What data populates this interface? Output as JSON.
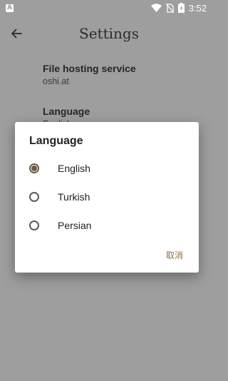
{
  "status_bar": {
    "notification_icon": "A",
    "time": "3:52",
    "icons": [
      "wifi-icon",
      "no-sim-icon",
      "battery-charging-icon"
    ]
  },
  "app_bar": {
    "title": "Settings",
    "back_icon": "arrow-left-icon"
  },
  "settings": [
    {
      "title": "File hosting service",
      "summary": "oshi.at"
    },
    {
      "title": "Language",
      "summary": "English"
    }
  ],
  "dialog": {
    "title": "Language",
    "options": [
      {
        "label": "English",
        "selected": true
      },
      {
        "label": "Turkish",
        "selected": false
      },
      {
        "label": "Persian",
        "selected": false
      }
    ],
    "cancel_label": "取消"
  },
  "colors": {
    "scrim": "#9e9e9e",
    "accent": "#6b5a43",
    "cancel_text": "#8d7140"
  }
}
